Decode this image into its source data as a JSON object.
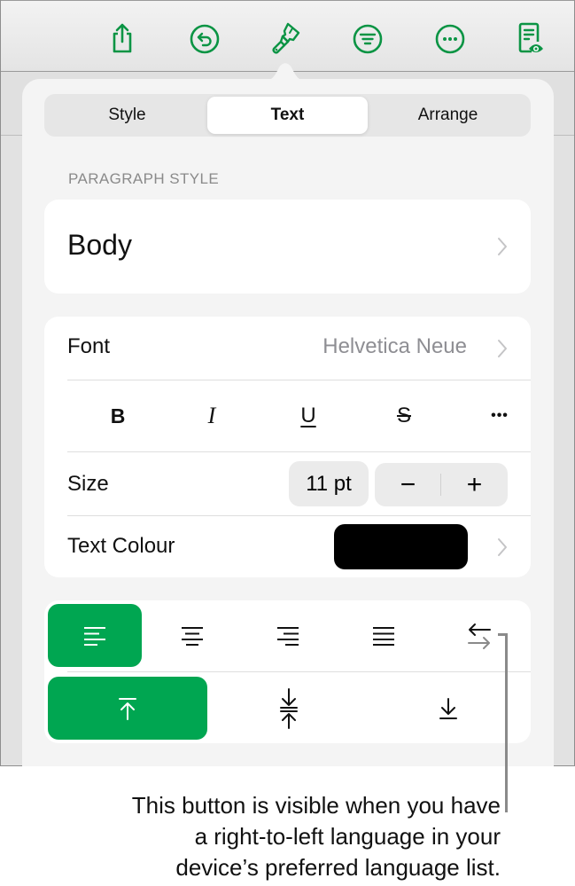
{
  "toolbar": {
    "icons": [
      {
        "name": "share-icon"
      },
      {
        "name": "undo-icon"
      },
      {
        "name": "format-brush-icon"
      },
      {
        "name": "filter-icon"
      },
      {
        "name": "more-icon"
      },
      {
        "name": "reading-view-icon"
      }
    ],
    "accent_color": "#0b9444"
  },
  "popover": {
    "tabs": [
      {
        "label": "Style",
        "active": false
      },
      {
        "label": "Text",
        "active": true
      },
      {
        "label": "Arrange",
        "active": false
      }
    ],
    "paragraph_style": {
      "section_label": "PARAGRAPH STYLE",
      "value": "Body"
    },
    "font": {
      "label": "Font",
      "value": "Helvetica Neue"
    },
    "format_buttons": [
      {
        "label": "B",
        "name": "bold-button"
      },
      {
        "label": "I",
        "name": "italic-button"
      },
      {
        "label": "U",
        "name": "underline-button"
      },
      {
        "label": "S",
        "name": "strikethrough-button"
      },
      {
        "label": "•••",
        "name": "more-text-options-button"
      }
    ],
    "size": {
      "label": "Size",
      "value": "11 pt",
      "decrement": "−",
      "increment": "+"
    },
    "text_colour": {
      "label": "Text Colour",
      "swatch": "#000000"
    },
    "alignment": {
      "horizontal": [
        {
          "name": "align-left",
          "active": true
        },
        {
          "name": "align-center",
          "active": false
        },
        {
          "name": "align-right",
          "active": false
        },
        {
          "name": "align-justify",
          "active": false
        },
        {
          "name": "text-direction",
          "active": false
        }
      ],
      "vertical": [
        {
          "name": "align-top",
          "active": true
        },
        {
          "name": "align-middle",
          "active": false
        },
        {
          "name": "align-bottom",
          "active": false
        }
      ],
      "active_color": "#00a651"
    }
  },
  "callout": {
    "text": "This button is visible when you have a right-to-left language in your device’s preferred language list.",
    "lines": [
      "This button is visible when you have",
      "a right-to-left language in your",
      "device’s preferred language list."
    ]
  }
}
